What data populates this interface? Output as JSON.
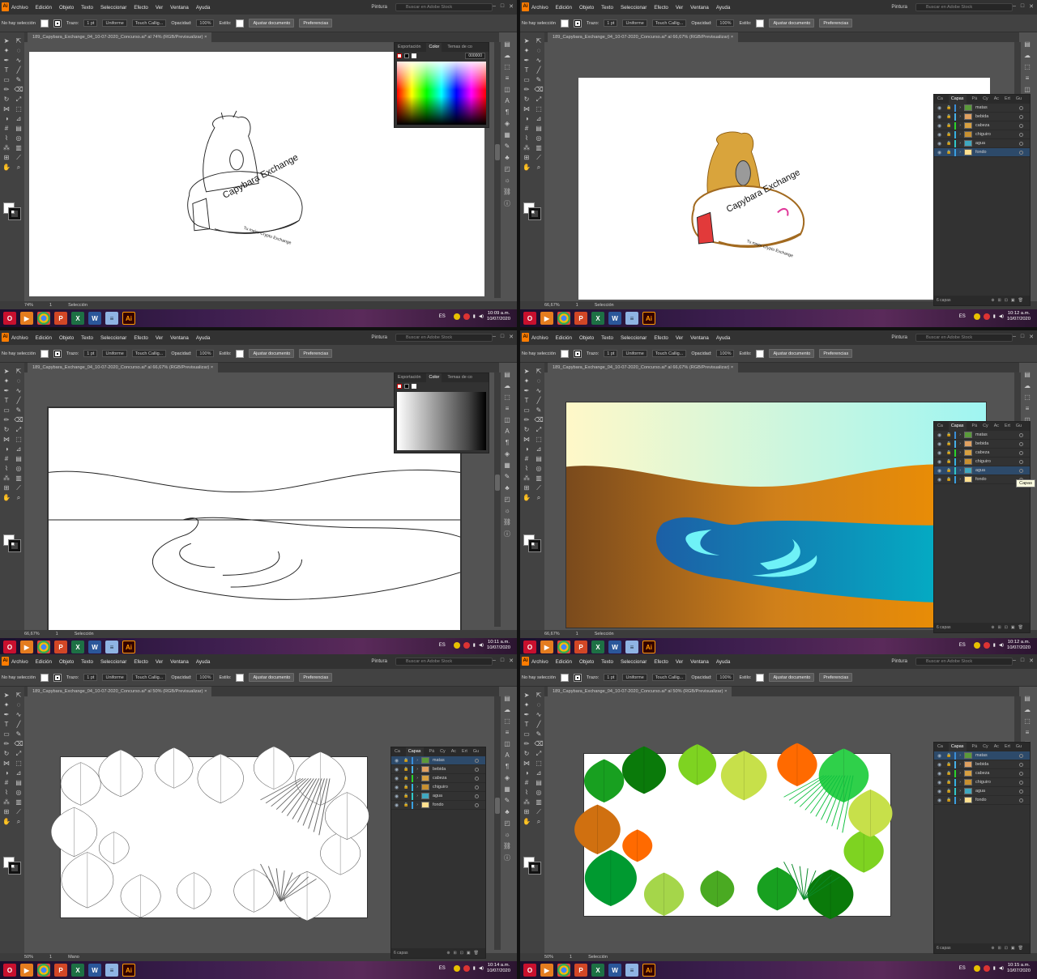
{
  "menu": [
    "Archivo",
    "Edición",
    "Objeto",
    "Texto",
    "Seleccionar",
    "Efecto",
    "Ver",
    "Ventana",
    "Ayuda"
  ],
  "workspace": "Pintura",
  "stock_search_placeholder": "Buscar en Adobe Stock",
  "no_selection": "No hay selección",
  "stroke_label": "Trazo:",
  "stroke_weight": "1 pt",
  "stroke_profile": "Uniforme",
  "brush": "Touch Callig...",
  "opacity_label": "Opacidad:",
  "opacity_value": "100%",
  "style_label": "Estilo:",
  "fit_doc_button": "Ajustar documento",
  "prefs_button": "Preferencias",
  "doc_name_prefix": "189_Capybara_Exchange_04_10-07-2020_Concurso.ai*",
  "color_mode": "(RGB/Previsualizar)",
  "status_tool": "Selección",
  "lang": "ES",
  "date": "10/07/2020",
  "panel_tabs_color": [
    "Exportación",
    "Color",
    "Temas de co"
  ],
  "panel_tabs_layers": [
    "Ca",
    "Capas",
    "Pá",
    "Cy",
    "Ac",
    "Ert",
    "Gu"
  ],
  "hex_value": "000000",
  "layers": [
    "matas",
    "bebida",
    "cabeza",
    "chiguiro",
    "agua",
    "fondo"
  ],
  "layers_count": "6 capas",
  "capas_tooltip": "Capas",
  "logo_text": "Capybara Exchange",
  "logo_tagline": "Tu mejor Crypto Exchange",
  "panes": [
    {
      "zoom_label": "al 74%",
      "zoom": "74%",
      "time": "10:09 a.m.",
      "tool": "Selección"
    },
    {
      "zoom_label": "al 66,67%",
      "zoom": "66,67%",
      "time": "10:12 a.m.",
      "tool": "Selección"
    },
    {
      "zoom_label": "al 66,67%",
      "zoom": "66,67%",
      "time": "10:11 a.m.",
      "tool": "Selección"
    },
    {
      "zoom_label": "al 66,67%",
      "zoom": "66,67%",
      "time": "10:12 a.m.",
      "tool": "Selección"
    },
    {
      "zoom_label": "al 50%",
      "zoom": "50%",
      "time": "10:14 a.m.",
      "tool": "Mano"
    },
    {
      "zoom_label": "al 50%",
      "zoom": "50%",
      "time": "10:15 a.m.",
      "tool": "Selección"
    }
  ],
  "taskbar_apps": [
    "opera",
    "media",
    "chrome",
    "powerpoint",
    "excel",
    "word",
    "notepad",
    "illustrator"
  ],
  "colors": {
    "ai_orange": "#ff7c00",
    "selected_layer": "#2d4a6a",
    "ui_dark": "#323232"
  }
}
